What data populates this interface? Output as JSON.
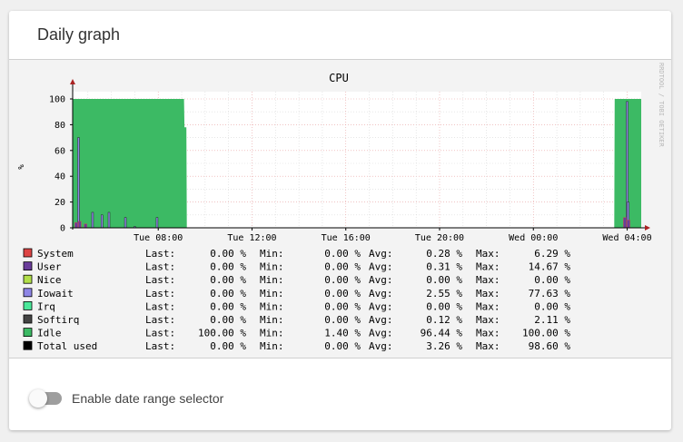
{
  "card": {
    "title": "Daily graph"
  },
  "chart_data": {
    "type": "area",
    "title": "CPU",
    "ylabel": "%",
    "ylim": [
      0,
      100
    ],
    "yticks": [
      "0",
      "20",
      "40",
      "60",
      "80",
      "100"
    ],
    "watermark": "RRDTOOL / TOBI OETIKER",
    "x_tick_labels": [
      "Tue 08:00",
      "Tue 12:00",
      "Tue 16:00",
      "Tue 20:00",
      "Wed 00:00",
      "Wed 04:00"
    ],
    "x_tick_hours": [
      8,
      12,
      16,
      20,
      24,
      28
    ],
    "xlim_hours": [
      4.35,
      28.6
    ],
    "grid": true,
    "idle_series": [
      [
        4.35,
        100
      ],
      [
        9.1,
        100
      ],
      [
        9.12,
        78
      ],
      [
        9.2,
        78
      ],
      [
        9.22,
        0
      ],
      [
        27.45,
        0
      ],
      [
        27.47,
        100
      ],
      [
        28.6,
        100
      ]
    ],
    "iowait_spikes": [
      {
        "x": 4.6,
        "y": 70
      },
      {
        "x": 5.2,
        "y": 12
      },
      {
        "x": 5.6,
        "y": 10
      },
      {
        "x": 5.9,
        "y": 12
      },
      {
        "x": 6.6,
        "y": 8
      },
      {
        "x": 7.95,
        "y": 8
      },
      {
        "x": 7.0,
        "y": 1
      },
      {
        "x": 28.0,
        "y": 98
      },
      {
        "x": 28.04,
        "y": 20
      }
    ],
    "user_spikes": [
      {
        "x": 4.5,
        "y": 4
      },
      {
        "x": 4.65,
        "y": 5
      },
      {
        "x": 4.9,
        "y": 3
      },
      {
        "x": 27.9,
        "y": 8
      },
      {
        "x": 28.06,
        "y": 6
      }
    ],
    "legend": [
      {
        "name": "System",
        "color": "#dd4444",
        "last": "0.00 %",
        "min": "0.00 %",
        "avg": "0.28 %",
        "max": "6.29 %"
      },
      {
        "name": "User",
        "color": "#6a3d9a",
        "last": "0.00 %",
        "min": "0.00 %",
        "avg": "0.31 %",
        "max": "14.67 %"
      },
      {
        "name": "Nice",
        "color": "#b2df4a",
        "last": "0.00 %",
        "min": "0.00 %",
        "avg": "0.00 %",
        "max": "0.00 %"
      },
      {
        "name": "Iowait",
        "color": "#8e86e6",
        "last": "0.00 %",
        "min": "0.00 %",
        "avg": "2.55 %",
        "max": "77.63 %"
      },
      {
        "name": "Irq",
        "color": "#4ae89a",
        "last": "0.00 %",
        "min": "0.00 %",
        "avg": "0.00 %",
        "max": "0.00 %"
      },
      {
        "name": "Softirq",
        "color": "#444444",
        "last": "0.00 %",
        "min": "0.00 %",
        "avg": "0.12 %",
        "max": "2.11 %"
      },
      {
        "name": "Idle",
        "color": "#3cba64",
        "last": "100.00 %",
        "min": "1.40 %",
        "avg": "96.44 %",
        "max": "100.00 %"
      },
      {
        "name": "Total used",
        "color": "#000000",
        "last": "0.00 %",
        "min": "0.00 %",
        "avg": "3.26 %",
        "max": "98.60 %"
      }
    ],
    "stat_labels": {
      "last": "Last:",
      "min": "Min:",
      "avg": "Avg:",
      "max": "Max:"
    }
  },
  "colors": {
    "idle": "#3cba64",
    "iowait": "#8e86e6",
    "user": "#6a3d9a",
    "grid_major": "#e8a0a0",
    "grid_minor": "#d8d8d8",
    "axis_arrow": "#aa2222"
  },
  "toggle": {
    "label": "Enable date range selector",
    "checked": false
  }
}
